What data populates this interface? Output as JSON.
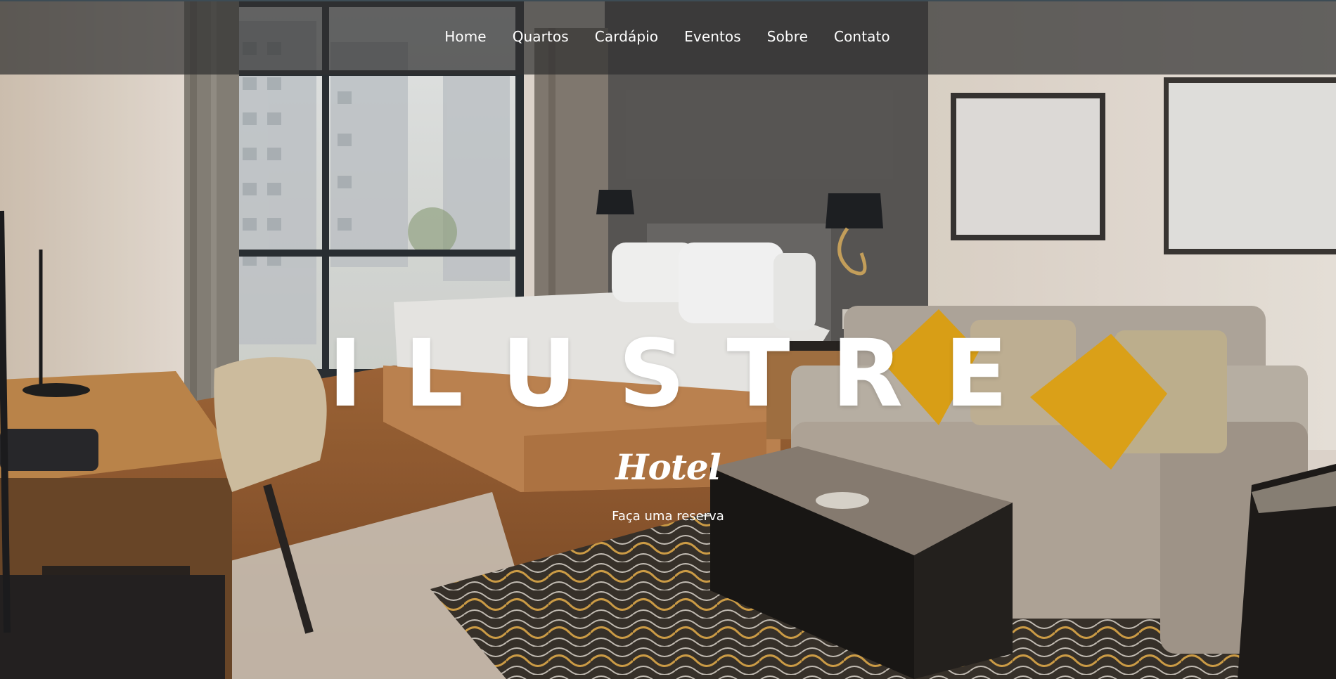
{
  "navbar": {
    "items": [
      {
        "label": "Home"
      },
      {
        "label": "Quartos"
      },
      {
        "label": "Cardápio"
      },
      {
        "label": "Eventos"
      },
      {
        "label": "Sobre"
      },
      {
        "label": "Contato"
      }
    ]
  },
  "hero": {
    "title": "ILUSTRE",
    "subtitle": "Hotel",
    "cta_label": "Faça uma reserva",
    "background": "hotel-room-photo"
  },
  "colors": {
    "nav_background": "#303030",
    "text": "#ffffff",
    "pillow_accent": "#e6a818",
    "floor_wood": "#b0713a",
    "wall_dark": "#5a5856"
  }
}
